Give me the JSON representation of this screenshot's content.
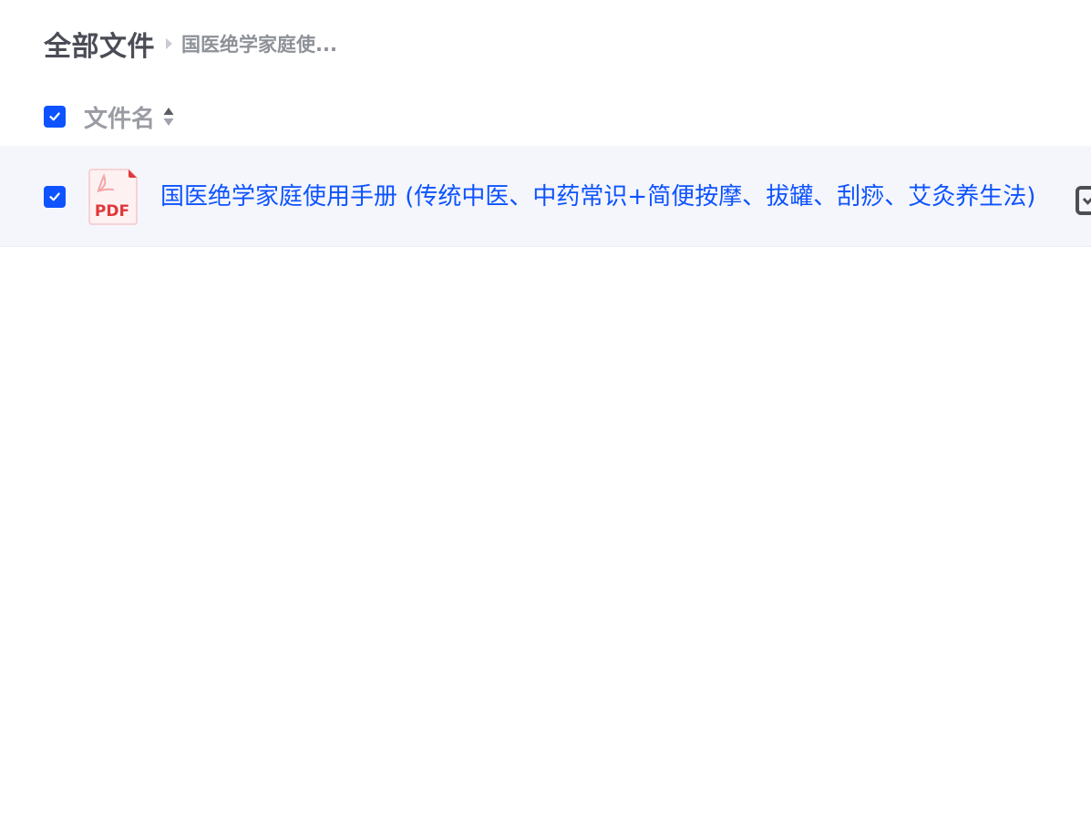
{
  "breadcrumb": {
    "root": "全部文件",
    "current": "国医绝学家庭使..."
  },
  "list_header": {
    "name_column": "文件名",
    "select_all_checked": true
  },
  "files": [
    {
      "name": "国医绝学家庭使用手册 (传统中医、中药常识+简便按摩、拔罐、刮痧、艾灸养生法)",
      "type": "PDF",
      "icon": "pdf-file-icon",
      "checked": true
    }
  ],
  "colors": {
    "accent": "#0d53ff",
    "row_selected_bg": "#f5f6fc",
    "pdf_red": "#e0383b"
  }
}
